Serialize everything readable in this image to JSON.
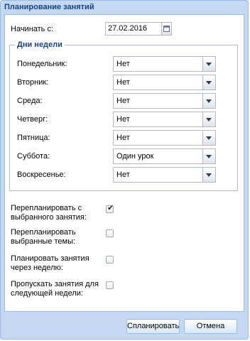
{
  "window": {
    "title": "Планирование занятий"
  },
  "start": {
    "label": "Начинать с:",
    "date": "27.02.2016"
  },
  "days": {
    "legend": "Дни недели",
    "items": [
      {
        "label": "Понедельник:",
        "value": "Нет"
      },
      {
        "label": "Вторник:",
        "value": "Нет"
      },
      {
        "label": "Среда:",
        "value": "Нет"
      },
      {
        "label": "Четверг:",
        "value": "Нет"
      },
      {
        "label": "Пятница:",
        "value": "Нет"
      },
      {
        "label": "Суббота:",
        "value": "Один урок"
      },
      {
        "label": "Воскресенье:",
        "value": "Нет"
      }
    ]
  },
  "options": [
    {
      "line1": "Перепланировать с",
      "line2": "выбранного занятия:",
      "checked": true
    },
    {
      "line1": "Перепланировать",
      "line2": "выбранные темы:",
      "checked": false
    },
    {
      "line1": "Планировать занятия",
      "line2": "через неделю:",
      "checked": false
    },
    {
      "line1": "Пропускать занятия для",
      "line2": "следующей недели:",
      "checked": false
    }
  ],
  "check_glyph": "✔",
  "buttons": {
    "plan": "Спланировать",
    "cancel": "Отмена"
  }
}
